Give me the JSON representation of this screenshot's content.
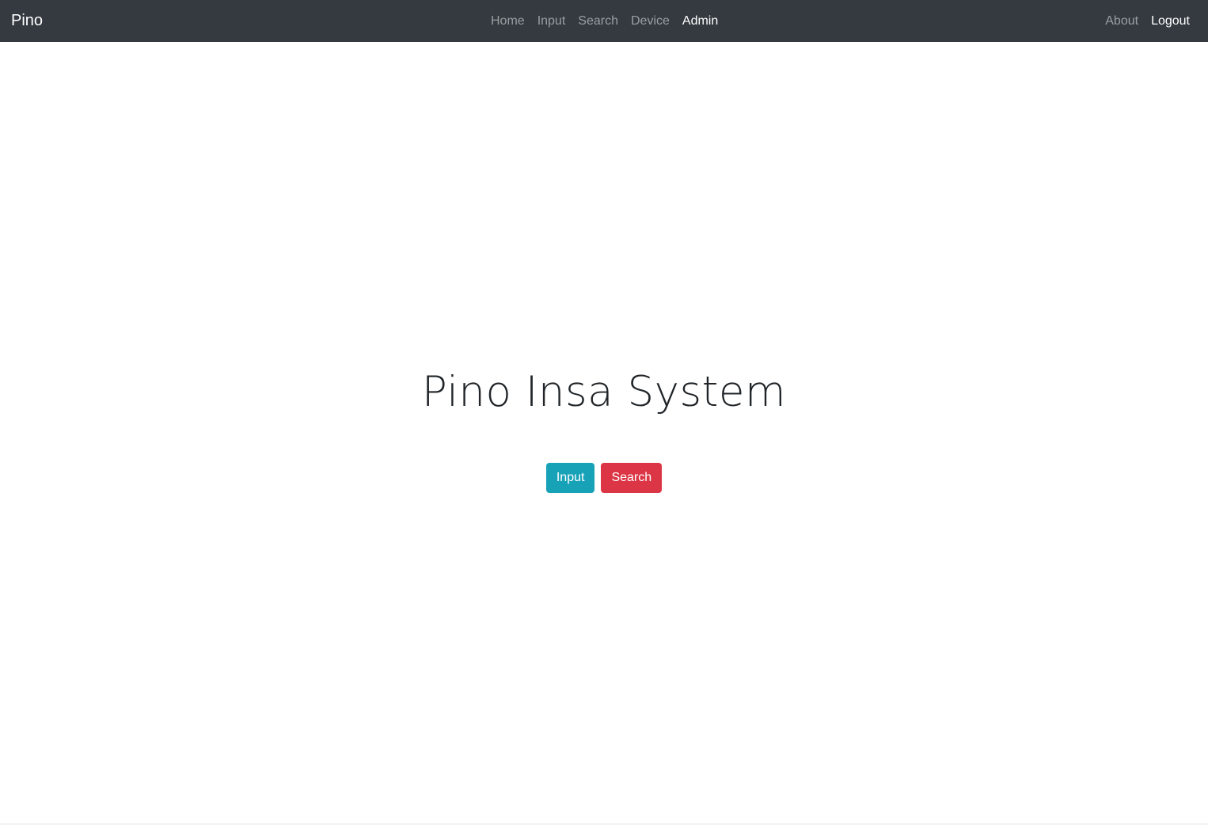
{
  "navbar": {
    "brand": "Pino",
    "center_items": [
      {
        "label": "Home",
        "active": false
      },
      {
        "label": "Input",
        "active": false
      },
      {
        "label": "Search",
        "active": false
      },
      {
        "label": "Device",
        "active": false
      },
      {
        "label": "Admin",
        "active": true
      }
    ],
    "right_items": [
      {
        "label": "About",
        "active": false
      },
      {
        "label": "Logout",
        "active": true
      }
    ]
  },
  "hero": {
    "title": "Pino Insa System",
    "input_button": "Input",
    "search_button": "Search"
  },
  "colors": {
    "navbar_bg": "#343a40",
    "info": "#17a2b8",
    "danger": "#dc3545",
    "title_text": "#212529"
  }
}
